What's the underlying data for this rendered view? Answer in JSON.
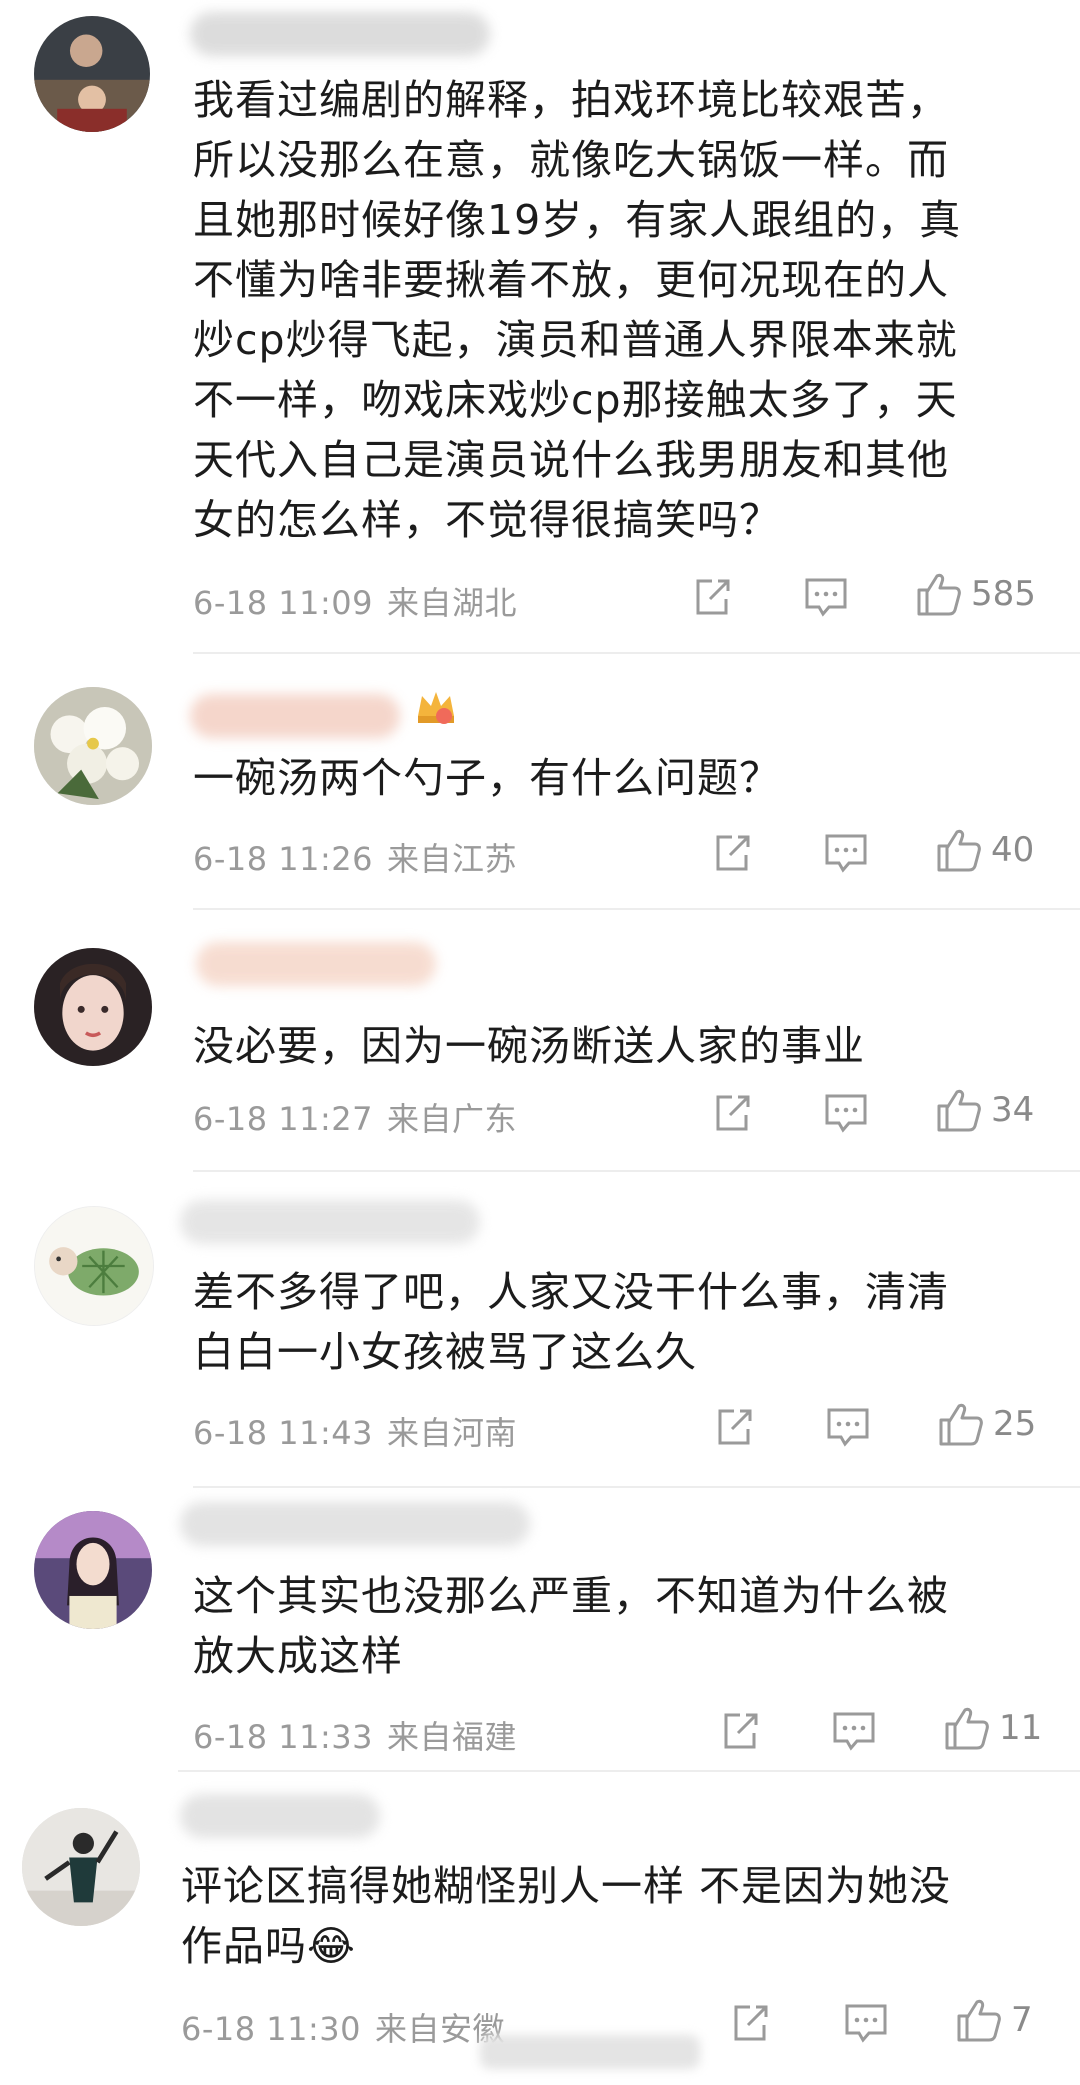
{
  "comments": [
    {
      "text": "我看过编剧的解释，拍戏环境比较艰苦，\n所以没那么在意，就像吃大锅饭一样。而\n且她那时候好像19岁，有家人跟组的，真\n不懂为啥非要揪着不放，更何况现在的人\n炒cp炒得飞起，演员和普通人界限本来就\n不一样，吻戏床戏炒cp那接触太多了，天\n天代入自己是演员说什么我男朋友和其他\n女的怎么样，不觉得很搞笑吗？",
      "time": "6-18 11:09",
      "location": "来自湖北",
      "likes": "585"
    },
    {
      "text": "一碗汤两个勺子，有什么问题？",
      "time": "6-18 11:26",
      "location": "来自江苏",
      "likes": "40"
    },
    {
      "text": "没必要，因为一碗汤断送人家的事业",
      "time": "6-18 11:27",
      "location": "来自广东",
      "likes": "34"
    },
    {
      "text": "差不多得了吧，人家又没干什么事，清清\n白白一小女孩被骂了这么久",
      "time": "6-18 11:43",
      "location": "来自河南",
      "likes": "25"
    },
    {
      "text": "这个其实也没那么严重，不知道为什么被\n放大成这样",
      "time": "6-18 11:33",
      "location": "来自福建",
      "likes": "11"
    },
    {
      "text": "评论区搞得她糊怪别人一样 不是因为她没\n作品吗😂",
      "time": "6-18 11:30",
      "location": "来自安徽",
      "likes": "7"
    }
  ],
  "icons": {
    "share": "share-icon",
    "comment": "comment-icon",
    "like": "thumbs-up-icon"
  }
}
